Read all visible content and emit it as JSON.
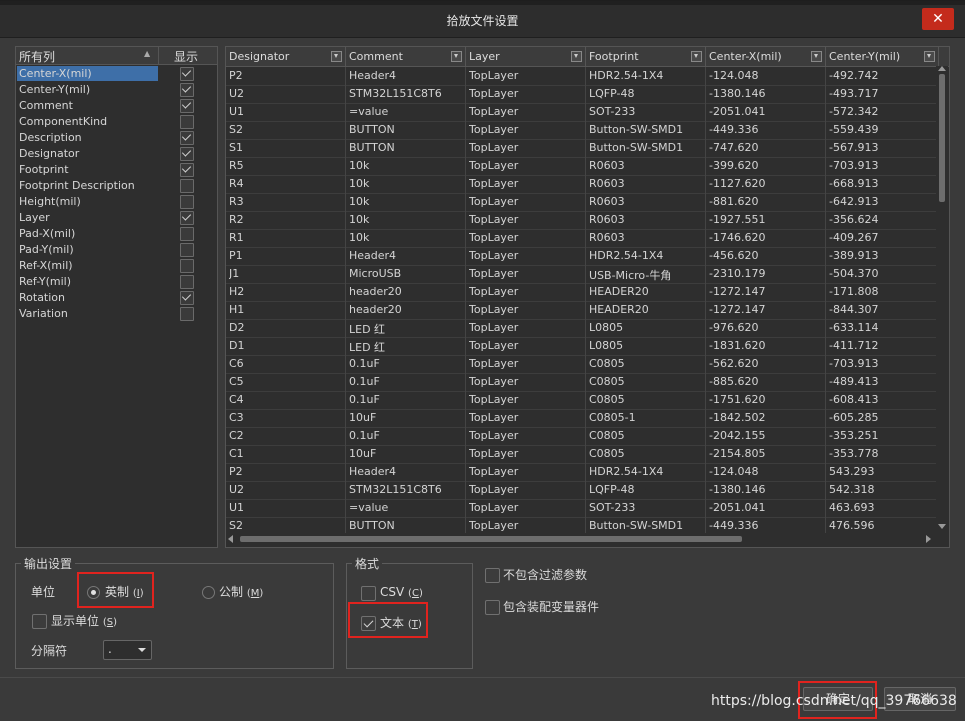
{
  "dialog": {
    "title": "拾放文件设置",
    "close_icon": "close-icon"
  },
  "columns_panel": {
    "header_all": "所有列",
    "header_show": "显示",
    "items": [
      {
        "label": "Center-X(mil)",
        "checked": true,
        "selected": true
      },
      {
        "label": "Center-Y(mil)",
        "checked": true
      },
      {
        "label": "Comment",
        "checked": true
      },
      {
        "label": "ComponentKind",
        "checked": false
      },
      {
        "label": "Description",
        "checked": true
      },
      {
        "label": "Designator",
        "checked": true
      },
      {
        "label": "Footprint",
        "checked": true
      },
      {
        "label": "Footprint Description",
        "checked": false
      },
      {
        "label": "Height(mil)",
        "checked": false
      },
      {
        "label": "Layer",
        "checked": true
      },
      {
        "label": "Pad-X(mil)",
        "checked": false
      },
      {
        "label": "Pad-Y(mil)",
        "checked": false
      },
      {
        "label": "Ref-X(mil)",
        "checked": false
      },
      {
        "label": "Ref-Y(mil)",
        "checked": false
      },
      {
        "label": "Rotation",
        "checked": true
      },
      {
        "label": "Variation",
        "checked": false
      }
    ]
  },
  "grid": {
    "headers": [
      "Designator",
      "Comment",
      "Layer",
      "Footprint",
      "Center-X(mil)",
      "Center-Y(mil)"
    ],
    "rows": [
      [
        "P2",
        "Header4",
        "TopLayer",
        "HDR2.54-1X4",
        "-124.048",
        "-492.742"
      ],
      [
        "U2",
        "STM32L151C8T6",
        "TopLayer",
        "LQFP-48",
        "-1380.146",
        "-493.717"
      ],
      [
        "U1",
        "=value",
        "TopLayer",
        "SOT-233",
        "-2051.041",
        "-572.342"
      ],
      [
        "S2",
        "BUTTON",
        "TopLayer",
        "Button-SW-SMD1",
        "-449.336",
        "-559.439"
      ],
      [
        "S1",
        "BUTTON",
        "TopLayer",
        "Button-SW-SMD1",
        "-747.620",
        "-567.913"
      ],
      [
        "R5",
        "10k",
        "TopLayer",
        "R0603",
        "-399.620",
        "-703.913"
      ],
      [
        "R4",
        "10k",
        "TopLayer",
        "R0603",
        "-1127.620",
        "-668.913"
      ],
      [
        "R3",
        "10k",
        "TopLayer",
        "R0603",
        "-881.620",
        "-642.913"
      ],
      [
        "R2",
        "10k",
        "TopLayer",
        "R0603",
        "-1927.551",
        "-356.624"
      ],
      [
        "R1",
        "10k",
        "TopLayer",
        "R0603",
        "-1746.620",
        "-409.267"
      ],
      [
        "P1",
        "Header4",
        "TopLayer",
        "HDR2.54-1X4",
        "-456.620",
        "-389.913"
      ],
      [
        "J1",
        "MicroUSB",
        "TopLayer",
        "USB-Micro-牛角",
        "-2310.179",
        "-504.370"
      ],
      [
        "H2",
        "header20",
        "TopLayer",
        "HEADER20",
        "-1272.147",
        "-171.808"
      ],
      [
        "H1",
        "header20",
        "TopLayer",
        "HEADER20",
        "-1272.147",
        "-844.307"
      ],
      [
        "D2",
        "LED 红",
        "TopLayer",
        "L0805",
        "-976.620",
        "-633.114"
      ],
      [
        "D1",
        "LED 红",
        "TopLayer",
        "L0805",
        "-1831.620",
        "-411.712"
      ],
      [
        "C6",
        "0.1uF",
        "TopLayer",
        "C0805",
        "-562.620",
        "-703.913"
      ],
      [
        "C5",
        "0.1uF",
        "TopLayer",
        "C0805",
        "-885.620",
        "-489.413"
      ],
      [
        "C4",
        "0.1uF",
        "TopLayer",
        "C0805",
        "-1751.620",
        "-608.413"
      ],
      [
        "C3",
        "10uF",
        "TopLayer",
        "C0805-1",
        "-1842.502",
        "-605.285"
      ],
      [
        "C2",
        "0.1uF",
        "TopLayer",
        "C0805",
        "-2042.155",
        "-353.251"
      ],
      [
        "C1",
        "10uF",
        "TopLayer",
        "C0805",
        "-2154.805",
        "-353.778"
      ],
      [
        "P2",
        "Header4",
        "TopLayer",
        "HDR2.54-1X4",
        "-124.048",
        "543.293"
      ],
      [
        "U2",
        "STM32L151C8T6",
        "TopLayer",
        "LQFP-48",
        "-1380.146",
        "542.318"
      ],
      [
        "U1",
        "=value",
        "TopLayer",
        "SOT-233",
        "-2051.041",
        "463.693"
      ],
      [
        "S2",
        "BUTTON",
        "TopLayer",
        "Button-SW-SMD1",
        "-449.336",
        "476.596"
      ]
    ]
  },
  "output_settings": {
    "title": "输出设置",
    "unit_label": "单位",
    "imperial": "英制",
    "imperial_key": "I",
    "metric": "公制",
    "metric_key": "M",
    "show_units": "显示单位",
    "show_units_key": "S",
    "separator_label": "分隔符",
    "separator_value": "."
  },
  "format": {
    "title": "格式",
    "csv": "CSV",
    "csv_key": "C",
    "text": "文本",
    "text_key": "T"
  },
  "options": {
    "exclude_filter": "不包含过滤参数",
    "include_variant": "包含装配变量器件"
  },
  "buttons": {
    "ok": "确定",
    "cancel": "取消"
  },
  "watermark": "https://blog.csdn.net/qq_39766638"
}
